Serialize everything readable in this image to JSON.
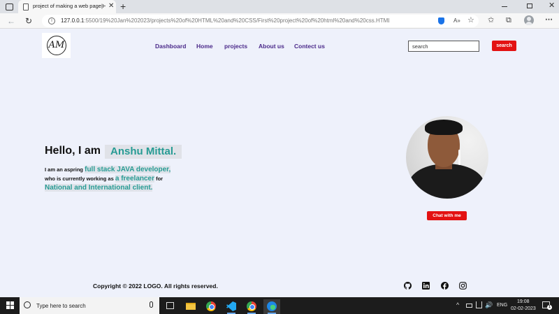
{
  "browser": {
    "tab_title": "project of making a web page|H",
    "tab_close_glyph": "✕",
    "new_tab_glyph": "+",
    "url_host": "127.0.0.1",
    "url_path": ":5500/19%20Jan%202023/projects%20of%20HTML%20and%20CSS/First%20project%20of%20html%20and%20css.HTML",
    "back_glyph": "←",
    "reload_glyph": "↻",
    "read_aloud_glyph": "A»",
    "add_fav_glyph": "☆",
    "favorites_glyph": "✩",
    "collections_glyph": "⧉",
    "menu_glyph": "⋯",
    "close_glyph": "✕"
  },
  "page": {
    "logo_text": "AM",
    "nav": {
      "items": [
        "Dashboard",
        "Home",
        "projects",
        "About us",
        "Contect us"
      ]
    },
    "search": {
      "placeholder": "search",
      "button_label": "search"
    },
    "hero": {
      "greeting": "Hello, I am",
      "name": "Anshu Mittal.",
      "bio_line1_a": "I am an aspring ",
      "bio_line1_hl": "full stack JAVA developer,",
      "bio_line2_a": "who is currently working as ",
      "bio_line2_hl": "a freelancer",
      "bio_line2_b": " for",
      "bio_line3_hl": "National and International client."
    },
    "chat_button": "Chat with me",
    "footer": {
      "copyright": "Copyright © 2022 LOGO. All rights reserved.",
      "social_icons": [
        "github-icon",
        "linkedin-icon",
        "facebook-icon",
        "instagram-icon"
      ]
    },
    "colors": {
      "background": "#eef1fb",
      "nav_text": "#4b2a8a",
      "accent_red": "#e31212",
      "highlight_teal": "#279b94"
    }
  },
  "taskbar": {
    "search_text": "Type here to search",
    "tray_chevron": "^",
    "volume_glyph": "🔊",
    "language": "ENG",
    "time": "19:08",
    "date": "02-02-2023",
    "notification_count": "1"
  }
}
